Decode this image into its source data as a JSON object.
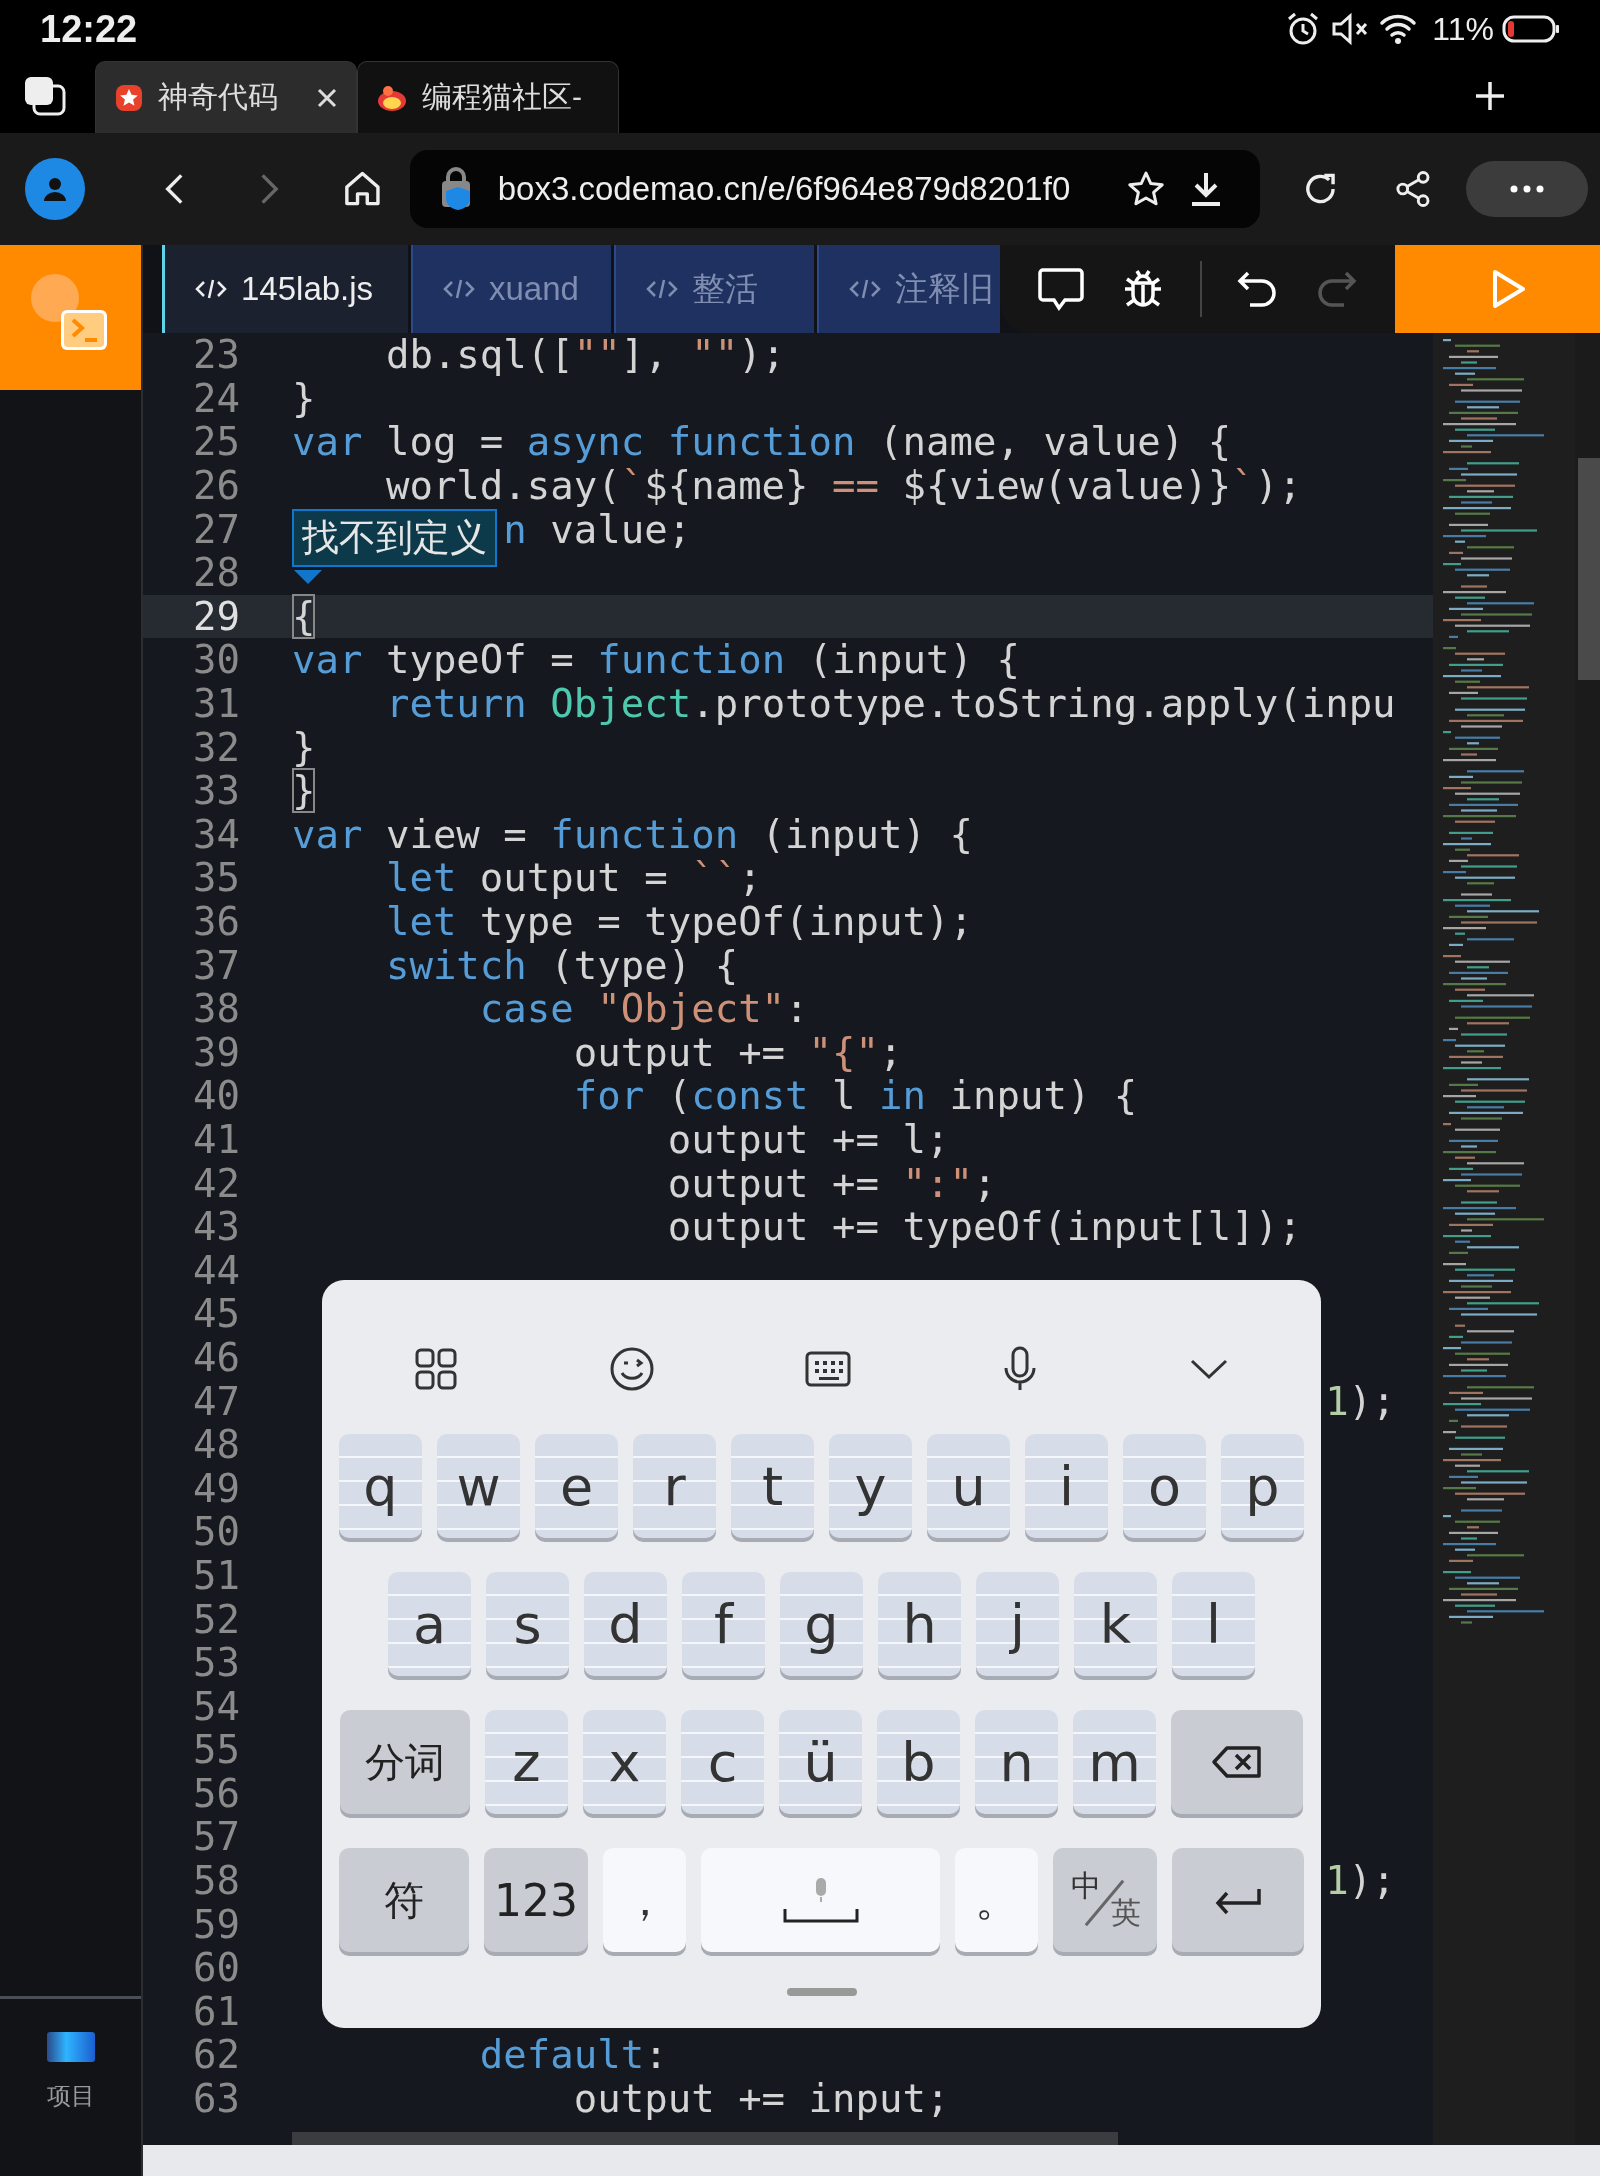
{
  "status_bar": {
    "time": "12:22",
    "battery": "11%"
  },
  "browser_tabs": [
    {
      "title": "神奇代码",
      "selected": true
    },
    {
      "title": "编程猫社区-",
      "selected": false
    }
  ],
  "address_bar": {
    "url": "box3.codemao.cn/e/6f964e879d8201f0",
    "forward_disabled": true
  },
  "editor": {
    "tabs": [
      {
        "label": "145lab.js",
        "selected": true
      },
      {
        "label": "xuand",
        "selected": false
      },
      {
        "label": "整活",
        "selected": false
      },
      {
        "label": "注释旧",
        "selected": false
      }
    ],
    "redo_disabled": true,
    "tooltip": "找不到定义",
    "sidebar_label": "项目",
    "lines": [
      {
        "number": "23",
        "current": false,
        "tokens": [
          {
            "kind": "plain",
            "text": "    db.sql(["
          },
          {
            "kind": "string",
            "text": "\"\""
          },
          {
            "kind": "plain",
            "text": "], "
          },
          {
            "kind": "string",
            "text": "\"\""
          },
          {
            "kind": "plain",
            "text": ");"
          }
        ]
      },
      {
        "number": "24",
        "current": false,
        "tokens": [
          {
            "kind": "plain",
            "text": "}"
          }
        ]
      },
      {
        "number": "25",
        "current": false,
        "tokens": [
          {
            "kind": "keyword",
            "text": "var"
          },
          {
            "kind": "plain",
            "text": " log = "
          },
          {
            "kind": "keyword",
            "text": "async"
          },
          {
            "kind": "keyword",
            "text": " function"
          },
          {
            "kind": "plain",
            "text": " (name, value) {"
          }
        ]
      },
      {
        "number": "26",
        "current": false,
        "tokens": [
          {
            "kind": "plain",
            "text": "    world.say("
          },
          {
            "kind": "string",
            "text": "`"
          },
          {
            "kind": "plain",
            "text": "${name} "
          },
          {
            "kind": "string",
            "text": "=="
          },
          {
            "kind": "plain",
            "text": " ${view(value)}"
          },
          {
            "kind": "string",
            "text": "`"
          },
          {
            "kind": "plain",
            "text": ");"
          }
        ]
      },
      {
        "number": "27",
        "current": false,
        "tokens": [
          {
            "kind": "keyword",
            "text": "         n"
          },
          {
            "kind": "plain",
            "text": " value;"
          }
        ]
      },
      {
        "number": "28",
        "current": false
      },
      {
        "number": "29",
        "current": true,
        "tokens": [
          {
            "kind": "bracket",
            "text": "{"
          }
        ]
      },
      {
        "number": "30",
        "current": false,
        "tokens": [
          {
            "kind": "keyword",
            "text": "var"
          },
          {
            "kind": "plain",
            "text": " typeOf = "
          },
          {
            "kind": "keyword",
            "text": "function"
          },
          {
            "kind": "plain",
            "text": " (input) {"
          }
        ]
      },
      {
        "number": "31",
        "current": false,
        "tokens": [
          {
            "kind": "keyword",
            "text": "    return"
          },
          {
            "kind": "class",
            "text": " Object"
          },
          {
            "kind": "plain",
            "text": ".prototype.toString.apply(inpu"
          }
        ]
      },
      {
        "number": "32",
        "current": false,
        "tokens": [
          {
            "kind": "plain",
            "text": "}"
          }
        ]
      },
      {
        "number": "33",
        "current": false,
        "tokens": [
          {
            "kind": "bracket",
            "text": "}"
          }
        ]
      },
      {
        "number": "34",
        "current": false,
        "tokens": [
          {
            "kind": "keyword",
            "text": "var"
          },
          {
            "kind": "plain",
            "text": " view = "
          },
          {
            "kind": "keyword",
            "text": "function"
          },
          {
            "kind": "plain",
            "text": " (input) {"
          }
        ]
      },
      {
        "number": "35",
        "current": false,
        "tokens": [
          {
            "kind": "keyword",
            "text": "    let"
          },
          {
            "kind": "plain",
            "text": " output = "
          },
          {
            "kind": "string",
            "text": "``"
          },
          {
            "kind": "plain",
            "text": ";"
          }
        ]
      },
      {
        "number": "36",
        "current": false,
        "tokens": [
          {
            "kind": "keyword",
            "text": "    let"
          },
          {
            "kind": "plain",
            "text": " type = typeOf(input);"
          }
        ]
      },
      {
        "number": "37",
        "current": false,
        "tokens": [
          {
            "kind": "keyword",
            "text": "    switch"
          },
          {
            "kind": "plain",
            "text": " (type) {"
          }
        ]
      },
      {
        "number": "38",
        "current": false,
        "tokens": [
          {
            "kind": "keyword",
            "text": "        case"
          },
          {
            "kind": "string",
            "text": " \"Object\""
          },
          {
            "kind": "plain",
            "text": ":"
          }
        ]
      },
      {
        "number": "39",
        "current": false,
        "tokens": [
          {
            "kind": "plain",
            "text": "            output += "
          },
          {
            "kind": "string",
            "text": "\"{\""
          },
          {
            "kind": "plain",
            "text": ";"
          }
        ]
      },
      {
        "number": "40",
        "current": false,
        "tokens": [
          {
            "kind": "keyword",
            "text": "            for"
          },
          {
            "kind": "plain",
            "text": " ("
          },
          {
            "kind": "keyword",
            "text": "const"
          },
          {
            "kind": "plain",
            "text": " l "
          },
          {
            "kind": "keyword",
            "text": "in"
          },
          {
            "kind": "plain",
            "text": " input) {"
          }
        ]
      },
      {
        "number": "41",
        "current": false,
        "tokens": [
          {
            "kind": "plain",
            "text": "                output += l;"
          }
        ]
      },
      {
        "number": "42",
        "current": false,
        "tokens": [
          {
            "kind": "plain",
            "text": "                output += "
          },
          {
            "kind": "string",
            "text": "\":\""
          },
          {
            "kind": "plain",
            "text": ";"
          }
        ]
      },
      {
        "number": "43",
        "current": false,
        "tokens": [
          {
            "kind": "plain",
            "text": "                output += typeOf(input[l]);"
          }
        ]
      },
      {
        "number": "44",
        "current": false
      },
      {
        "number": "45",
        "current": false
      },
      {
        "number": "46",
        "current": false
      },
      {
        "number": "47",
        "current": false,
        "tokens": [
          {
            "kind": "number",
            "text": "                                            1"
          },
          {
            "kind": "plain",
            "text": ");"
          }
        ]
      },
      {
        "number": "48",
        "current": false
      },
      {
        "number": "49",
        "current": false
      },
      {
        "number": "50",
        "current": false
      },
      {
        "number": "51",
        "current": false
      },
      {
        "number": "52",
        "current": false
      },
      {
        "number": "53",
        "current": false
      },
      {
        "number": "54",
        "current": false
      },
      {
        "number": "55",
        "current": false
      },
      {
        "number": "56",
        "current": false
      },
      {
        "number": "57",
        "current": false
      },
      {
        "number": "58",
        "current": false,
        "tokens": [
          {
            "kind": "number",
            "text": "                                            1"
          },
          {
            "kind": "plain",
            "text": ");"
          }
        ]
      },
      {
        "number": "59",
        "current": false
      },
      {
        "number": "60",
        "current": false
      },
      {
        "number": "61",
        "current": false
      },
      {
        "number": "62",
        "current": false,
        "tokens": [
          {
            "kind": "keyword",
            "text": "        default"
          },
          {
            "kind": "plain",
            "text": ":"
          }
        ]
      },
      {
        "number": "63",
        "current": false,
        "tokens": [
          {
            "kind": "plain",
            "text": "            output += input;"
          }
        ]
      }
    ]
  },
  "keyboard": {
    "rows": [
      {
        "keys": [
          {
            "kind": "letter",
            "label": "q"
          },
          {
            "kind": "letter",
            "label": "w"
          },
          {
            "kind": "letter",
            "label": "e"
          },
          {
            "kind": "letter",
            "label": "r"
          },
          {
            "kind": "letter",
            "label": "t"
          },
          {
            "kind": "letter",
            "label": "y"
          },
          {
            "kind": "letter",
            "label": "u"
          },
          {
            "kind": "letter",
            "label": "i"
          },
          {
            "kind": "letter",
            "label": "o"
          },
          {
            "kind": "letter",
            "label": "p"
          }
        ]
      },
      {
        "keys": [
          {
            "kind": "letter",
            "label": "a"
          },
          {
            "kind": "letter",
            "label": "s"
          },
          {
            "kind": "letter",
            "label": "d"
          },
          {
            "kind": "letter",
            "label": "f"
          },
          {
            "kind": "letter",
            "label": "g"
          },
          {
            "kind": "letter",
            "label": "h"
          },
          {
            "kind": "letter",
            "label": "j"
          },
          {
            "kind": "letter",
            "label": "k"
          },
          {
            "kind": "letter",
            "label": "l"
          }
        ]
      },
      {
        "keys": [
          {
            "kind": "function",
            "label": "分词"
          },
          {
            "kind": "letter",
            "label": "z"
          },
          {
            "kind": "letter",
            "label": "x"
          },
          {
            "kind": "letter",
            "label": "c"
          },
          {
            "kind": "letter",
            "label": "ü"
          },
          {
            "kind": "letter",
            "label": "b"
          },
          {
            "kind": "letter",
            "label": "n"
          },
          {
            "kind": "letter",
            "label": "m"
          },
          {
            "kind": "backspace"
          }
        ]
      },
      {
        "keys": [
          {
            "kind": "function",
            "label": "符"
          },
          {
            "kind": "number",
            "label": "123"
          },
          {
            "kind": "punct",
            "label": "，"
          },
          {
            "kind": "space"
          },
          {
            "kind": "punct",
            "label": "。"
          },
          {
            "kind": "lang",
            "label": "中",
            "label_2": "英"
          },
          {
            "kind": "enter"
          }
        ]
      }
    ]
  }
}
